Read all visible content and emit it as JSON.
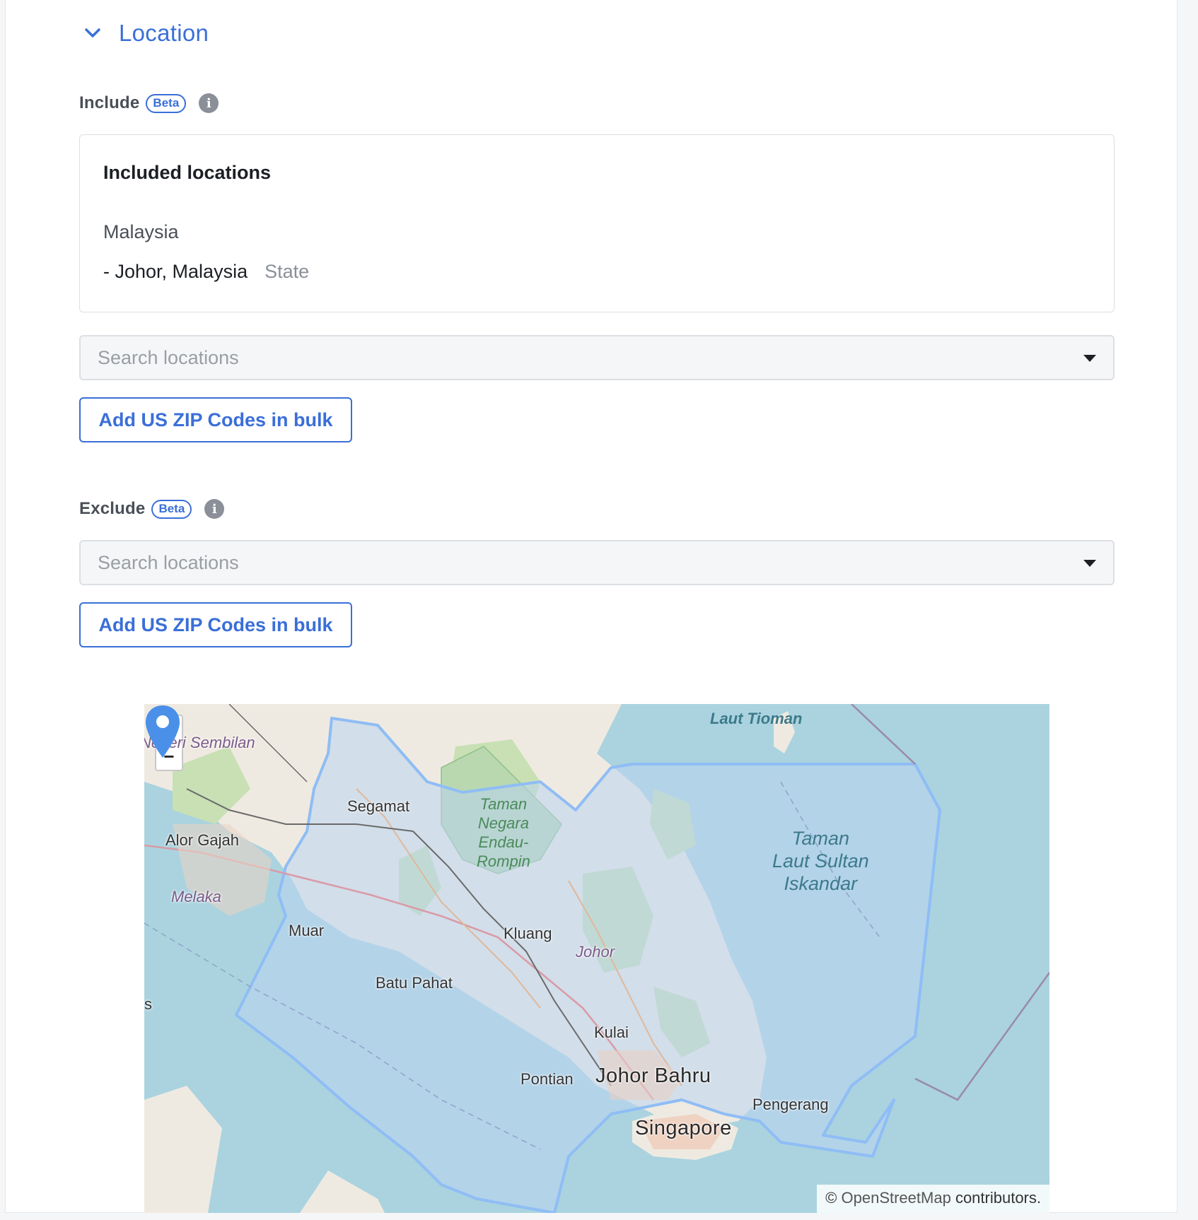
{
  "section": {
    "title": "Location"
  },
  "include": {
    "label": "Include",
    "badge": "Beta",
    "box_title": "Included locations",
    "country": "Malaysia",
    "location_name": "- Johor, Malaysia",
    "location_type": "State",
    "search_placeholder": "Search locations",
    "bulk_button": "Add US ZIP Codes in bulk"
  },
  "exclude": {
    "label": "Exclude",
    "badge": "Beta",
    "search_placeholder": "Search locations",
    "bulk_button": "Add US ZIP Codes in bulk"
  },
  "map": {
    "zoom_in": "+",
    "zoom_out": "−",
    "labels": {
      "negeri_sembilan": "Negeri Sembilan",
      "segamat": "Segamat",
      "taman_negara": [
        "Taman",
        "Negara",
        "Endau-",
        "Rompin"
      ],
      "laut_tioman": "Laut Tioman",
      "taman_laut": [
        "Taman",
        "Laut Sultan",
        "Iskandar"
      ],
      "alor_gajah": "Alor Gajah",
      "melaka": "Melaka",
      "muar": "Muar",
      "kluang": "Kluang",
      "johor": "Johor",
      "batu_pahat": "Batu Pahat",
      "kulai": "Kulai",
      "pontian": "Pontian",
      "johor_bahru": "Johor Bahru",
      "pengerang": "Pengerang",
      "singapore": "Singapore",
      "edge_s": "s"
    },
    "attribution_symbol": "©",
    "attribution_link": "OpenStreetMap",
    "attribution_suffix": "contributors.",
    "colors": {
      "sea": "#aad3df",
      "land": "#efeae1",
      "forest": "#c8e0b4",
      "park": "#b9d8b0",
      "boundary": "#8fbdf5",
      "highlight": "#b9d4f0",
      "pin": "#4a90e8"
    }
  }
}
